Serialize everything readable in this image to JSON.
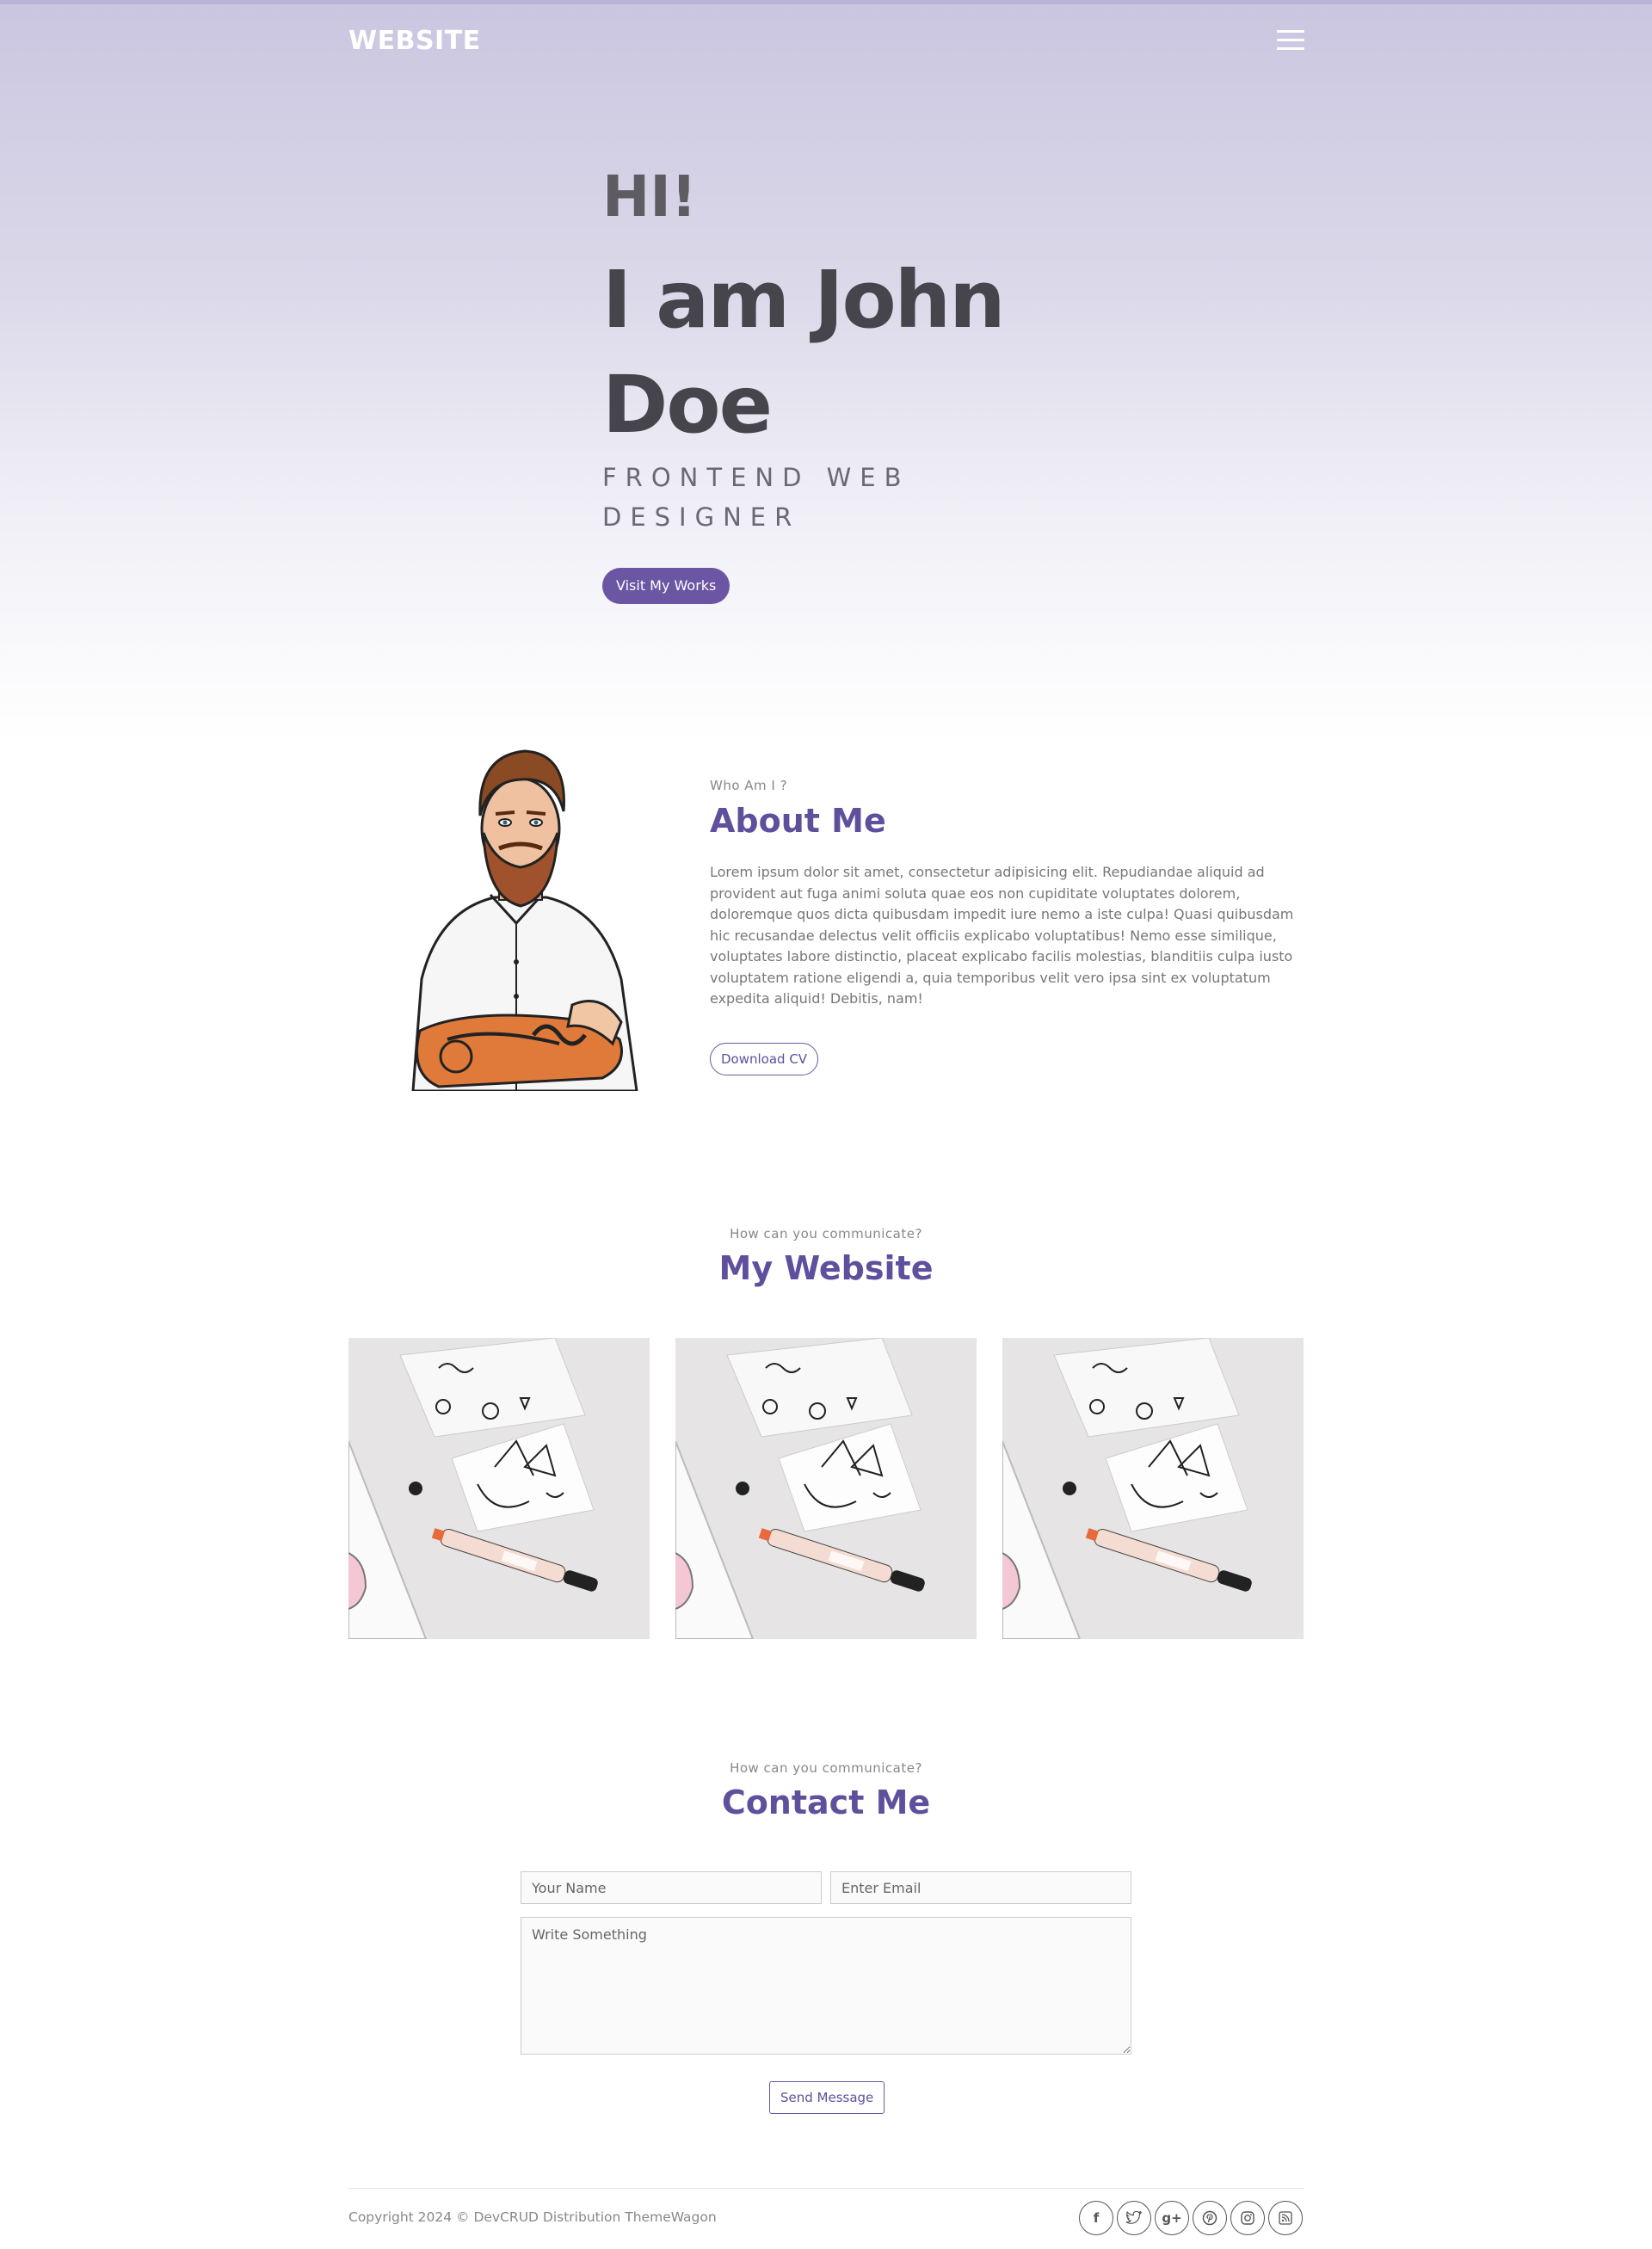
{
  "nav": {
    "brand": "WEBSITE",
    "menu_icon": "hamburger-menu-icon"
  },
  "hero": {
    "greeting": "HI!",
    "name": "I am John Doe",
    "role": "FRONTEND WEB DESIGNER",
    "cta_label": "Visit My Works"
  },
  "about": {
    "eyebrow": "Who Am I ?",
    "title": "About Me",
    "text": "Lorem ipsum dolor sit amet, consectetur adipisicing elit. Repudiandae aliquid ad provident aut fuga animi soluta quae eos non cupiditate voluptates dolorem, doloremque quos dicta quibusdam impedit iure nemo a iste culpa! Quasi quibusdam hic recusandae delectus velit officiis explicabo voluptatibus! Nemo esse similique, voluptates labore distinctio, placeat explicabo facilis molestias, blanditiis culpa iusto voluptatem ratione eligendi a, quia temporibus velit vero ipsa sint ex voluptatum expedita aliquid! Debitis, nam!",
    "download_label": "Download CV"
  },
  "website": {
    "eyebrow": "How can you communicate?",
    "title": "My Website",
    "cards": 3
  },
  "contact": {
    "eyebrow": "How can you communicate?",
    "title": "Contact Me",
    "name_placeholder": "Your Name",
    "email_placeholder": "Enter Email",
    "message_placeholder": "Write Something",
    "send_label": "Send Message"
  },
  "footer": {
    "copyright": "Copyright 2024 © DevCRUD Distribution ThemeWagon",
    "socials": [
      "facebook-icon",
      "twitter-icon",
      "google-plus-icon",
      "pinterest-icon",
      "instagram-icon",
      "rss-icon"
    ]
  },
  "colors": {
    "accent": "#6a56a3",
    "heading": "#5f4f9c",
    "hero_top": "#cac6e0"
  }
}
